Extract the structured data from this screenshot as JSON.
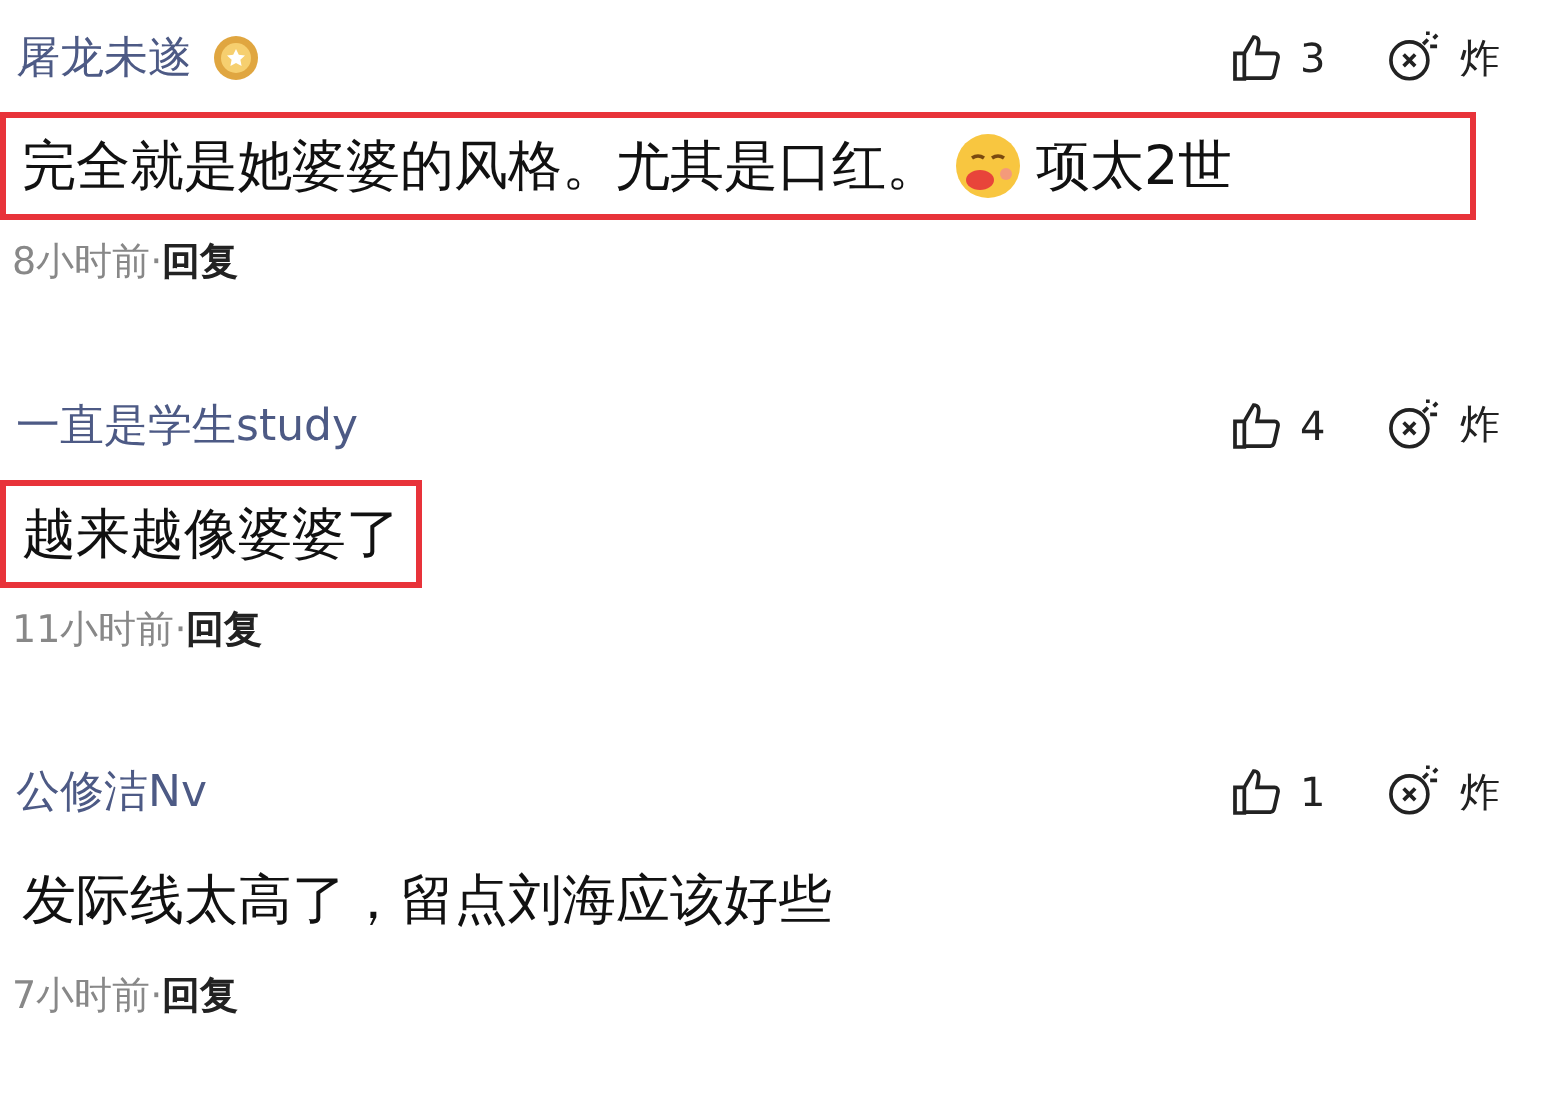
{
  "comments": [
    {
      "username": "屠龙未遂",
      "badge": true,
      "likes": "3",
      "bomb_label": "炸",
      "highlighted": true,
      "body": [
        {
          "kind": "text",
          "text": "完全就是她婆婆的风格。尤其是口红。"
        },
        {
          "kind": "emoji"
        },
        {
          "kind": "text",
          "text": "项太2世"
        }
      ],
      "time": "8小时前",
      "separator": "·",
      "reply": "回复"
    },
    {
      "username": "一直是学生study",
      "badge": false,
      "likes": "4",
      "bomb_label": "炸",
      "highlighted": true,
      "body": [
        {
          "kind": "text",
          "text": "越来越像婆婆了"
        }
      ],
      "time": "11小时前",
      "separator": "·",
      "reply": "回复"
    },
    {
      "username": "公修洁Nv",
      "badge": false,
      "likes": "1",
      "bomb_label": "炸",
      "highlighted": false,
      "body": [
        {
          "kind": "text",
          "text": "发际线太高了，留点刘海应该好些"
        }
      ],
      "time": "7小时前",
      "separator": "·",
      "reply": "回复"
    }
  ]
}
